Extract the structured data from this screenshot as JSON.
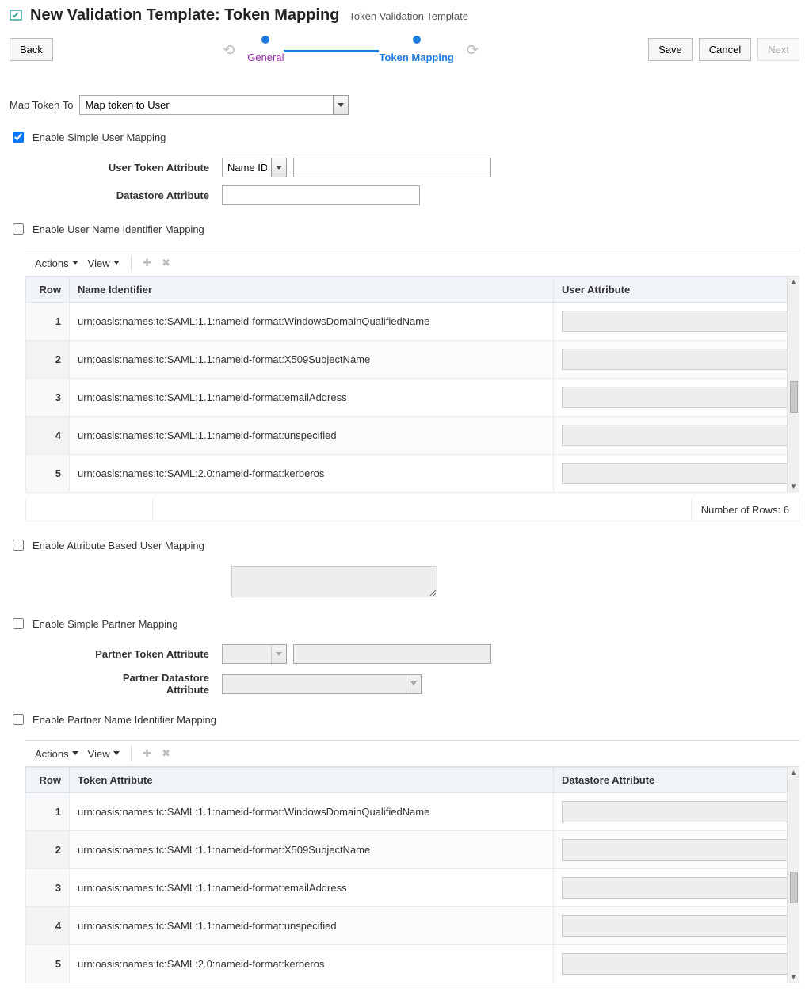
{
  "header": {
    "title": "New Validation Template: Token Mapping",
    "subtitle": "Token Validation Template"
  },
  "buttons": {
    "back": "Back",
    "save": "Save",
    "cancel": "Cancel",
    "next": "Next"
  },
  "train": {
    "step1": "General",
    "step2": "Token Mapping"
  },
  "fields": {
    "map_token_to_label": "Map Token To",
    "map_token_to_value": "Map token to User",
    "enable_simple_user": "Enable Simple User Mapping",
    "user_token_attr_label": "User Token Attribute",
    "user_token_attr_value": "Name ID",
    "datastore_attr_label": "Datastore Attribute",
    "enable_name_id_mapping": "Enable User Name Identifier Mapping",
    "actions_label": "Actions",
    "view_label": "View",
    "enable_attr_based": "Enable Attribute Based User Mapping",
    "enable_simple_partner": "Enable Simple Partner Mapping",
    "partner_token_attr_label": "Partner Token Attribute",
    "partner_datastore_attr_label": "Partner Datastore Attribute",
    "enable_partner_name_id": "Enable Partner Name Identifier Mapping"
  },
  "table1": {
    "col_row": "Row",
    "col_name_id": "Name Identifier",
    "col_user_attr": "User Attribute",
    "rows": [
      {
        "n": "1",
        "id": "urn:oasis:names:tc:SAML:1.1:nameid-format:WindowsDomainQualifiedName"
      },
      {
        "n": "2",
        "id": "urn:oasis:names:tc:SAML:1.1:nameid-format:X509SubjectName"
      },
      {
        "n": "3",
        "id": "urn:oasis:names:tc:SAML:1.1:nameid-format:emailAddress"
      },
      {
        "n": "4",
        "id": "urn:oasis:names:tc:SAML:1.1:nameid-format:unspecified"
      },
      {
        "n": "5",
        "id": "urn:oasis:names:tc:SAML:2.0:nameid-format:kerberos"
      }
    ],
    "footer": "Number of Rows: 6"
  },
  "table2": {
    "col_row": "Row",
    "col_token_attr": "Token Attribute",
    "col_datastore_attr": "Datastore Attribute",
    "rows": [
      {
        "n": "1",
        "id": "urn:oasis:names:tc:SAML:1.1:nameid-format:WindowsDomainQualifiedName"
      },
      {
        "n": "2",
        "id": "urn:oasis:names:tc:SAML:1.1:nameid-format:X509SubjectName"
      },
      {
        "n": "3",
        "id": "urn:oasis:names:tc:SAML:1.1:nameid-format:emailAddress"
      },
      {
        "n": "4",
        "id": "urn:oasis:names:tc:SAML:1.1:nameid-format:unspecified"
      },
      {
        "n": "5",
        "id": "urn:oasis:names:tc:SAML:2.0:nameid-format:kerberos"
      }
    ]
  }
}
